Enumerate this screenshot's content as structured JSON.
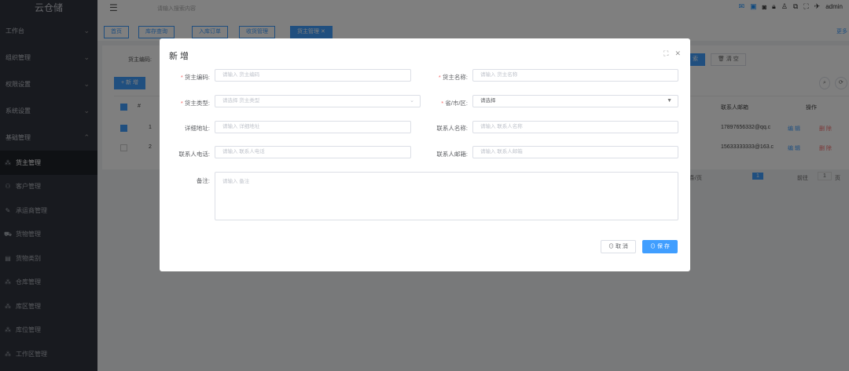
{
  "app": {
    "title": "云仓储"
  },
  "sidebar": {
    "menus": [
      {
        "label": "工作台",
        "chevron": "⌄"
      },
      {
        "label": "组织管理",
        "chevron": "⌄"
      },
      {
        "label": "权限设置",
        "chevron": "⌄"
      },
      {
        "label": "系统设置",
        "chevron": "⌄"
      },
      {
        "label": "基础管理",
        "chevron": "⌃"
      }
    ],
    "items": [
      {
        "label": "货主管理",
        "icon": "cluster-icon",
        "active": true
      },
      {
        "label": "客户管理",
        "icon": "user-icon"
      },
      {
        "label": "承运商管理",
        "icon": "edit-icon"
      },
      {
        "label": "货物管理",
        "icon": "goods-icon"
      },
      {
        "label": "货物类别",
        "icon": "document-icon"
      },
      {
        "label": "仓库管理",
        "icon": "cluster-icon"
      },
      {
        "label": "库区管理",
        "icon": "cluster-icon"
      },
      {
        "label": "库位管理",
        "icon": "cluster-icon"
      },
      {
        "label": "工作区管理",
        "icon": "cluster-icon"
      }
    ]
  },
  "topbar": {
    "search_placeholder": "请输入搜索内容",
    "user": "admin"
  },
  "tabs": [
    {
      "label": "首页"
    },
    {
      "label": "库存查询"
    },
    {
      "label": "入库订单"
    },
    {
      "label": "收货管理"
    },
    {
      "label": "货主管理",
      "active": true
    }
  ],
  "tabs_more": "更多",
  "background": {
    "search_label": "货主编码:",
    "search_btn": "索",
    "clear_btn": "清 空",
    "add_btn": "+ 新 增",
    "col_index": "#",
    "col_email": "联系人邮箱",
    "col_ops": "操作",
    "rows": [
      {
        "index": "1",
        "email": "17897656332@qq.c",
        "edit": "编 辑",
        "delete": "删 除"
      },
      {
        "index": "2",
        "email": "15633333333@163.c",
        "edit": "编 辑",
        "delete": "删 除"
      }
    ],
    "pager": {
      "per_page": "条/页",
      "current": "1",
      "goto": "前往",
      "page_input": "1",
      "page_unit": "页"
    }
  },
  "dialog": {
    "title": "新 增",
    "fields": {
      "owner_code": {
        "label": "货主编码:",
        "placeholder": "请输入 货主编码",
        "required": true
      },
      "owner_name": {
        "label": "货主名称:",
        "placeholder": "请输入 货主名称",
        "required": true
      },
      "owner_type": {
        "label": "货主类型:",
        "placeholder": "请选择 货主类型",
        "required": true
      },
      "region": {
        "label": "省/市/区:",
        "value": "请选择",
        "required": true
      },
      "address": {
        "label": "详细地址:",
        "placeholder": "请输入 详细地址"
      },
      "contact_name": {
        "label": "联系人名称:",
        "placeholder": "请输入 联系人名称"
      },
      "contact_phone": {
        "label": "联系人电话:",
        "placeholder": "请输入 联系人电话"
      },
      "contact_email": {
        "label": "联系人邮箱:",
        "placeholder": "请输入 联系人邮箱"
      },
      "remark": {
        "label": "备注:",
        "placeholder": "请输入 备注"
      }
    },
    "cancel_label": "取 消",
    "save_label": "保 存"
  }
}
